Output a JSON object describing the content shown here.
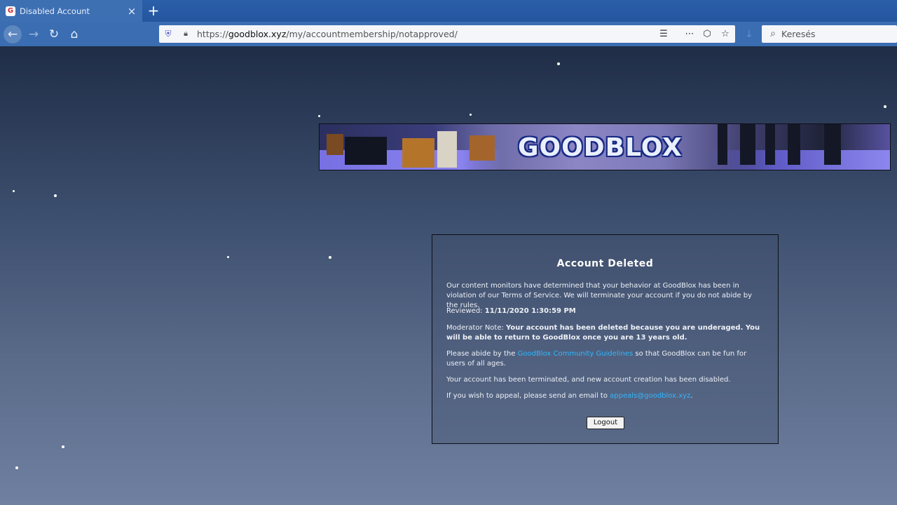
{
  "browser": {
    "tab": {
      "favicon_letter": "G",
      "title": "Disabled Account",
      "close": "×"
    },
    "new_tab": "+",
    "nav": {
      "back": "←",
      "forward": "→",
      "reload": "↻",
      "home": "⌂"
    },
    "url": {
      "scheme": "https://",
      "host": "goodblox.xyz",
      "path": "/my/accountmembership/notapproved/"
    },
    "search": {
      "placeholder": "Keresés"
    },
    "icons": {
      "shield": "shield-icon",
      "lock": "lock-icon",
      "reader": "reader-view-icon",
      "more": "more-icon",
      "pocket": "pocket-icon",
      "star": "bookmark-star-icon",
      "download": "download-icon",
      "search": "search-icon"
    }
  },
  "banner": {
    "logo_text": "GOODBLOX"
  },
  "notice": {
    "title": "Account Deleted",
    "intro": "Our content monitors have determined that your behavior at GoodBlox has been in violation of our Terms of Service. We will terminate your account if you do not abide by the rules.",
    "reviewed_label": "Reviewed:",
    "reviewed_value": "11/11/2020 1:30:59 PM",
    "moderator_label": "Moderator Note:",
    "moderator_note": "Your account has been deleted because you are underaged. You will be able to return to GoodBlox once you are 13 years old.",
    "guidelines_prefix": "Please abide by the",
    "guidelines_link": "GoodBlox Community Guidelines",
    "guidelines_suffix": "so that GoodBlox can be fun for users of all ages.",
    "terminated": "Your account has been terminated, and new account creation has been disabled.",
    "appeal_prefix": "If you wish to appeal, please send an email to",
    "appeal_email": "appeals@goodblox.xyz",
    "appeal_suffix": ".",
    "logout_label": "Logout"
  },
  "colors": {
    "chrome": "#3a6db1",
    "link": "#31b7ff",
    "panel_border": "#0c0f18"
  }
}
